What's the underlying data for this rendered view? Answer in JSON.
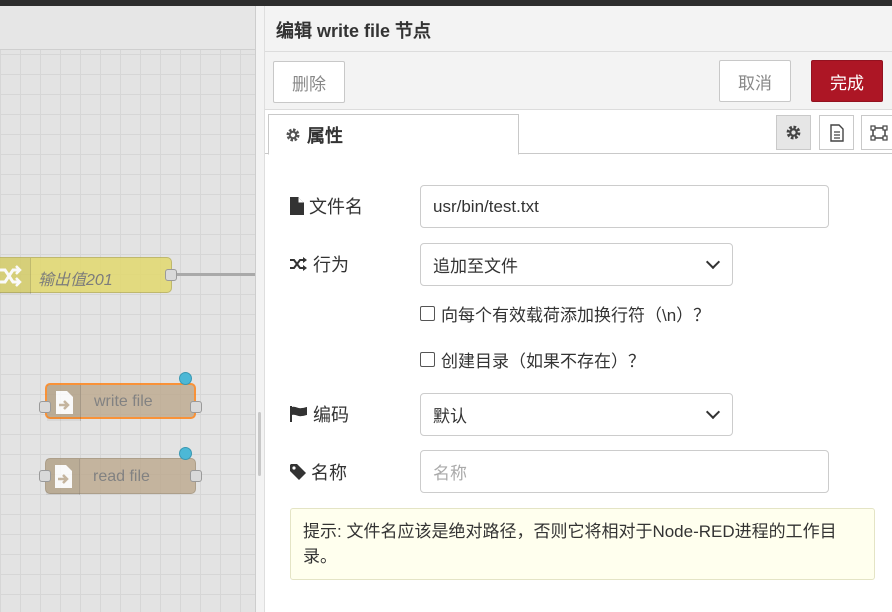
{
  "canvas": {
    "nodes": [
      {
        "label": "输出值201",
        "kind": "change"
      },
      {
        "label": "write file",
        "kind": "file-out",
        "selected": true
      },
      {
        "label": "read file",
        "kind": "file-in"
      }
    ]
  },
  "panel": {
    "title": "编辑 write file 节点",
    "buttons": {
      "delete": "删除",
      "cancel": "取消",
      "done": "完成"
    },
    "tabs": [
      {
        "label": "属性",
        "icon": "gear-icon"
      }
    ],
    "tab_buttons": [
      "gear-icon",
      "document-icon",
      "frame-icon"
    ],
    "form": {
      "filename": {
        "label": "文件名",
        "icon": "file-icon",
        "value": "usr/bin/test.txt"
      },
      "action": {
        "label": "行为",
        "icon": "shuffle-icon",
        "value": "追加至文件"
      },
      "append_newline": {
        "label": "向每个有效载荷添加换行符（\\n）？",
        "checked": false
      },
      "create_dir": {
        "label": "创建目录（如果不存在）？",
        "checked": false
      },
      "encoding": {
        "label": "编码",
        "icon": "flag-icon",
        "value": "默认"
      },
      "name": {
        "label": "名称",
        "icon": "tag-icon",
        "value": "",
        "placeholder": "名称"
      }
    },
    "tip": "提示: 文件名应该是绝对路径，否则它将相对于Node-RED进程的工作目录。"
  },
  "colors": {
    "done_button": "#ad1625",
    "change_node": "#e2d96e",
    "file_node": "#bda98d",
    "selection": "#ff7f0e",
    "status_dot": "#4cb8d6",
    "tip_background": "#ffffee"
  }
}
